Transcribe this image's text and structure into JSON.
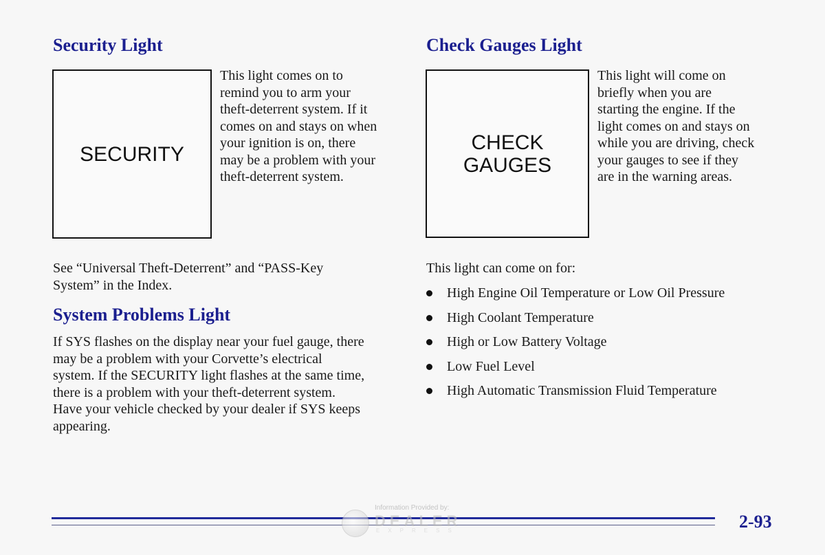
{
  "security_light": {
    "heading": "Security Light",
    "lamp_label": "SECURITY",
    "description_lines": [
      "This light comes on to",
      "remind you to arm your",
      "theft-deterrent system. If it",
      "comes on and stays on when",
      "your ignition is on, there",
      "may be a problem with your",
      "theft-deterrent system."
    ],
    "see_also_lines": [
      "See “Universal Theft-Deterrent” and “PASS-Key",
      "System” in the Index."
    ]
  },
  "system_problems_light": {
    "heading": "System Problems Light",
    "body_lines": [
      "If SYS flashes on the display near your fuel gauge, there",
      "may be a problem with your Corvette’s electrical",
      "system. If the SECURITY light flashes at the same time,",
      "there is a problem with your theft-deterrent system.",
      "Have your vehicle checked by your dealer if SYS keeps",
      "appearing."
    ]
  },
  "check_gauges_light": {
    "heading": "Check Gauges Light",
    "lamp_label_lines": [
      "CHECK",
      "GAUGES"
    ],
    "description_lines": [
      "This light will come on",
      "briefly when you are",
      "starting the engine. If the",
      "light comes on and stays on",
      "while you are driving, check",
      "your gauges to see if they",
      "are in the warning areas."
    ],
    "list_intro": "This light can come on for:",
    "conditions": [
      "High Engine Oil Temperature or Low Oil Pressure",
      "High Coolant Temperature",
      "High or Low Battery Voltage",
      "Low Fuel Level",
      "High Automatic Transmission Fluid Temperature"
    ]
  },
  "footer": {
    "page_number": "2-93",
    "watermark": {
      "caption": "Information Provided by:",
      "brand": "DEALER",
      "sub": "EXPRESS"
    }
  },
  "colors": {
    "heading": "#1b1f8f",
    "rule": "#1f2a9a",
    "text": "#1a1a1a",
    "background": "#f7f7f7"
  }
}
